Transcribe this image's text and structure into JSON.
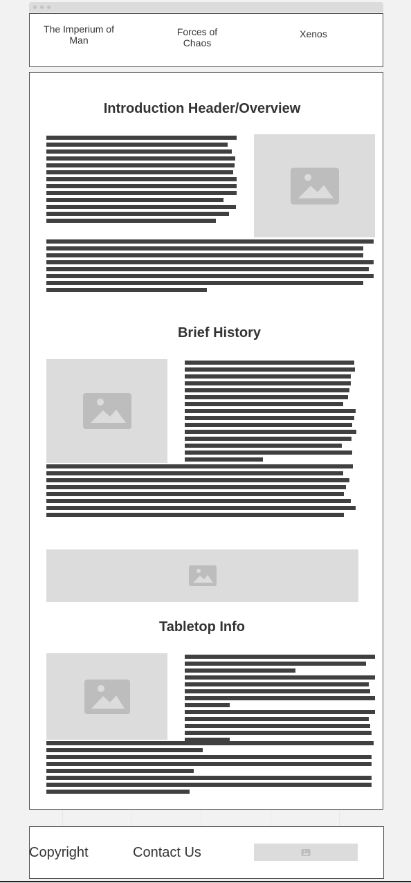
{
  "nav": {
    "items": [
      {
        "label": "The Imperium of Man"
      },
      {
        "label": "Forces of Chaos"
      },
      {
        "label": "Xenos"
      }
    ]
  },
  "sections": [
    {
      "heading": "Introduction Header/Overview"
    },
    {
      "heading": "Brief History"
    },
    {
      "heading": "Tabletop Info"
    }
  ],
  "footer": {
    "copyright": "Copyright",
    "contact": "Contact Us"
  },
  "icons": {
    "placeholder": "image-icon"
  },
  "colors": {
    "placeholder_bg": "#dcdcdc",
    "placeholder_icon": "#bdbdbd",
    "text_line": "#404040",
    "border": "#555555"
  }
}
